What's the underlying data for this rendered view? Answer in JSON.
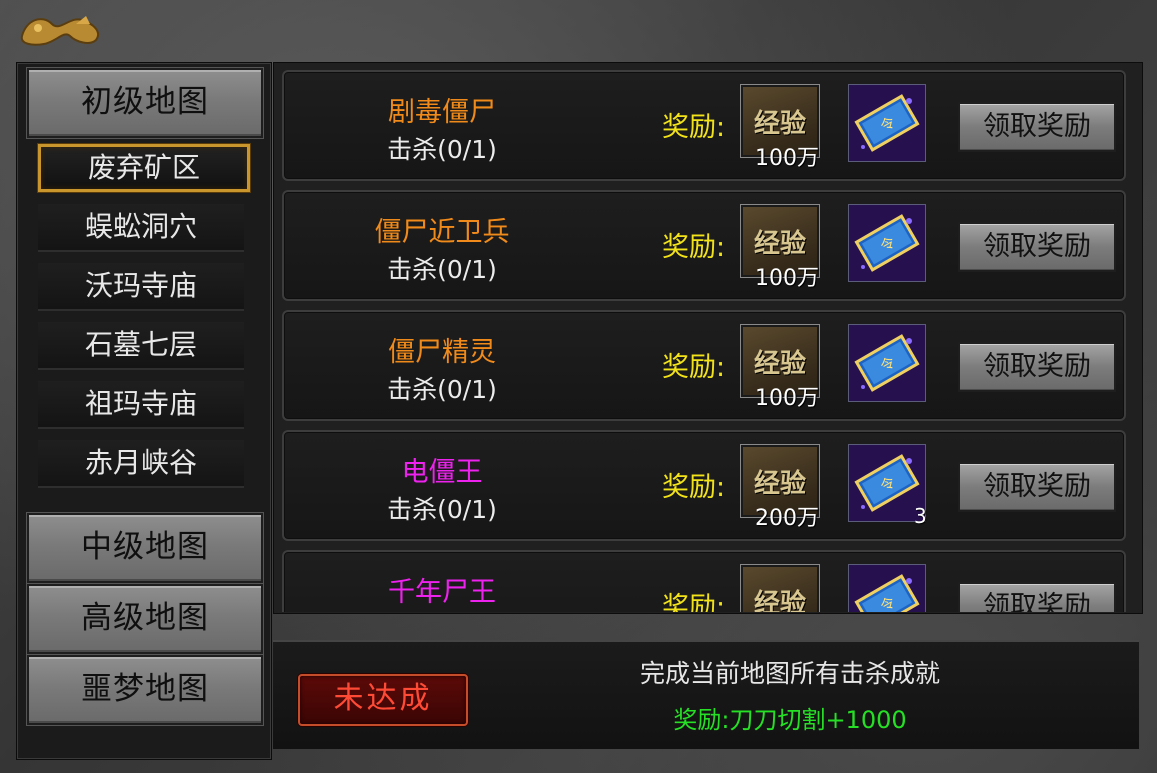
{
  "sidebar": {
    "groups": [
      {
        "label": "初级地图"
      },
      {
        "label": "中级地图"
      },
      {
        "label": "高级地图"
      },
      {
        "label": "噩梦地图"
      }
    ],
    "maps": [
      {
        "label": "废弃矿区",
        "selected": true
      },
      {
        "label": "蜈蚣洞穴"
      },
      {
        "label": "沃玛寺庙"
      },
      {
        "label": "石墓七层"
      },
      {
        "label": "祖玛寺庙"
      },
      {
        "label": "赤月峡谷"
      }
    ]
  },
  "tasks": [
    {
      "name": "剧毒僵尸",
      "name_color": "#f08a1a",
      "progress": "击杀(0/1)",
      "reward_label": "奖励:",
      "exp_label": "经验",
      "exp_amount": "100万",
      "card_count": "",
      "claim_label": "领取奖励"
    },
    {
      "name": "僵尸近卫兵",
      "name_color": "#f08a1a",
      "progress": "击杀(0/1)",
      "reward_label": "奖励:",
      "exp_label": "经验",
      "exp_amount": "100万",
      "card_count": "",
      "claim_label": "领取奖励"
    },
    {
      "name": "僵尸精灵",
      "name_color": "#f08a1a",
      "progress": "击杀(0/1)",
      "reward_label": "奖励:",
      "exp_label": "经验",
      "exp_amount": "100万",
      "card_count": "",
      "claim_label": "领取奖励"
    },
    {
      "name": "电僵王",
      "name_color": "#ee22ee",
      "progress": "击杀(0/1)",
      "reward_label": "奖励:",
      "exp_label": "经验",
      "exp_amount": "200万",
      "card_count": "3",
      "claim_label": "领取奖励"
    },
    {
      "name": "千年尸王",
      "name_color": "#ee22ee",
      "progress": "",
      "reward_label": "奖励:",
      "exp_label": "经验",
      "exp_amount": "",
      "card_count": "",
      "claim_label": "领取奖励"
    }
  ],
  "achievement": {
    "status_label": "未达成",
    "title": "完成当前地图所有击杀成就",
    "reward": "奖励:刀刀切割+1000"
  }
}
